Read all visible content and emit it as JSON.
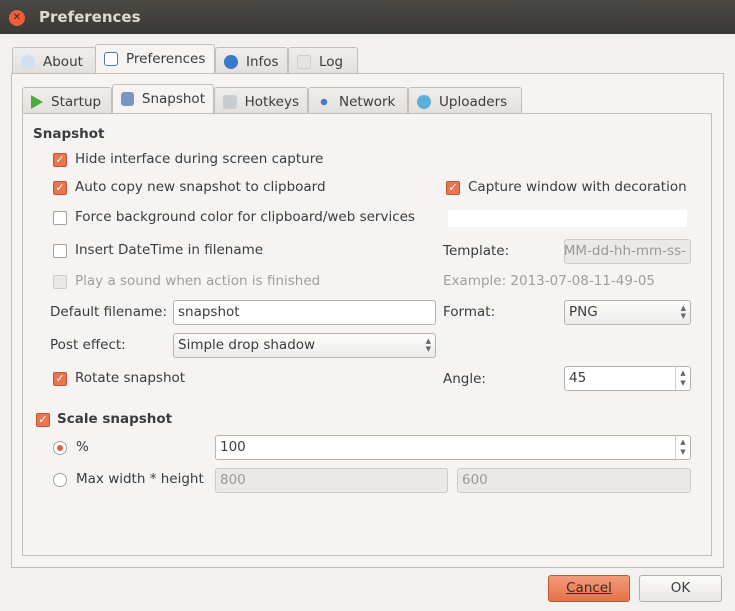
{
  "window": {
    "title": "Preferences"
  },
  "main_tabs": [
    {
      "label": "About"
    },
    {
      "label": "Preferences"
    },
    {
      "label": "Infos"
    },
    {
      "label": "Log"
    }
  ],
  "sub_tabs": [
    {
      "label": "Startup"
    },
    {
      "label": "Snapshot"
    },
    {
      "label": "Hotkeys"
    },
    {
      "label": "Network"
    },
    {
      "label": "Uploaders"
    }
  ],
  "snapshot": {
    "section_title": "Snapshot",
    "hide_interface": {
      "label": "Hide interface during screen capture",
      "checked": true
    },
    "auto_copy": {
      "label": "Auto copy new snapshot to clipboard",
      "checked": true
    },
    "capture_decoration": {
      "label": "Capture window with decoration",
      "checked": true
    },
    "force_bg": {
      "label": "Force background color for clipboard/web services",
      "checked": false
    },
    "insert_datetime": {
      "label": "Insert DateTime in filename",
      "checked": false
    },
    "play_sound": {
      "label": "Play a sound when action is finished",
      "checked": false
    },
    "template_label": "Template:",
    "template_value": "-MM-dd-hh-mm-ss",
    "example": "Example: 2013-07-08-11-49-05",
    "default_filename_label": "Default filename:",
    "default_filename": "snapshot",
    "format_label": "Format:",
    "format": "PNG",
    "post_effect_label": "Post effect:",
    "post_effect": "Simple drop shadow",
    "rotate": {
      "label": "Rotate snapshot",
      "checked": true
    },
    "angle_label": "Angle:",
    "angle": "45"
  },
  "scale": {
    "label": "Scale snapshot",
    "checked": true,
    "percent_label": "%",
    "percent_value": "100",
    "percent_selected": true,
    "max_label": "Max width * height",
    "width": "800",
    "height": "600"
  },
  "buttons": {
    "cancel": "Cancel",
    "ok": "OK"
  },
  "colors": {
    "accent": "#e8764e",
    "titlebar": "#3c3b37"
  }
}
